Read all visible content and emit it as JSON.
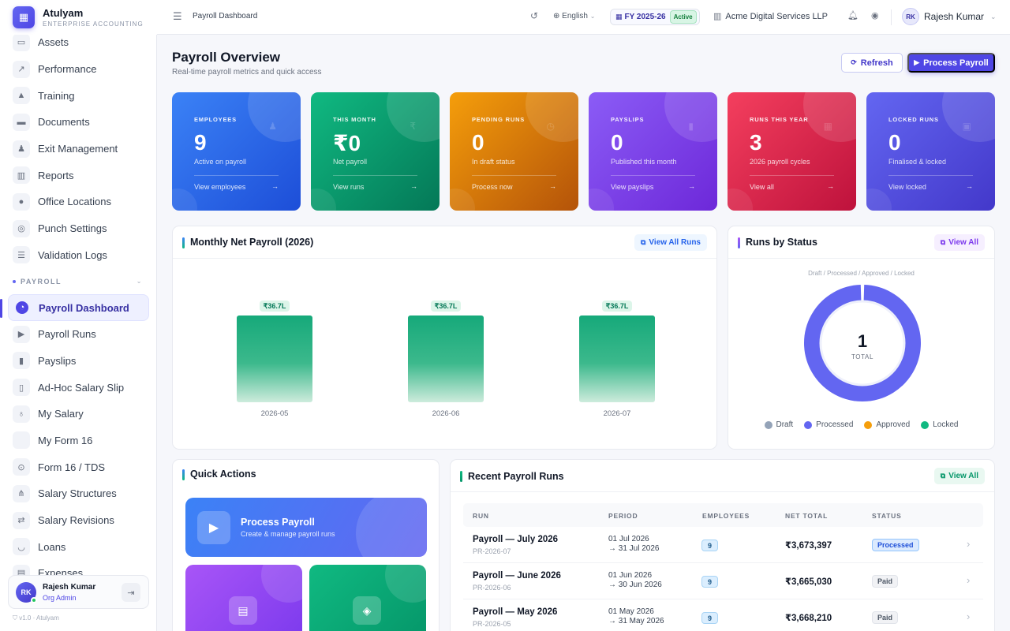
{
  "brand": {
    "name": "Atulyam",
    "subtitle": "ENTERPRISE ACCOUNTING"
  },
  "sidebar": {
    "items_top": [
      {
        "label": "Assets",
        "icon": "laptop-icon"
      },
      {
        "label": "Performance",
        "icon": "chart-line-icon"
      },
      {
        "label": "Training",
        "icon": "graduation-cap-icon"
      },
      {
        "label": "Documents",
        "icon": "folder-icon"
      },
      {
        "label": "Exit Management",
        "icon": "user-exit-icon"
      },
      {
        "label": "Reports",
        "icon": "report-chart-icon"
      },
      {
        "label": "Office Locations",
        "icon": "map-pin-icon"
      },
      {
        "label": "Punch Settings",
        "icon": "fingerprint-icon"
      },
      {
        "label": "Validation Logs",
        "icon": "list-check-icon"
      }
    ],
    "section_label": "PAYROLL",
    "items_payroll": [
      {
        "label": "Payroll Dashboard",
        "icon": "gauge-icon",
        "active": true
      },
      {
        "label": "Payroll Runs",
        "icon": "play-circle-icon"
      },
      {
        "label": "Payslips",
        "icon": "file-icon"
      },
      {
        "label": "Ad-Hoc Salary Slip",
        "icon": "file-plus-icon"
      },
      {
        "label": "My Salary",
        "icon": "money-bag-icon"
      },
      {
        "label": "My Form 16",
        "icon": "blank-icon"
      },
      {
        "label": "Form 16 / TDS",
        "icon": "hand-coin-icon"
      },
      {
        "label": "Salary Structures",
        "icon": "sitemap-icon"
      },
      {
        "label": "Salary Revisions",
        "icon": "exchange-icon"
      },
      {
        "label": "Loans",
        "icon": "hand-holding-icon"
      },
      {
        "label": "Expenses",
        "icon": "receipt-icon"
      }
    ],
    "user": {
      "initials": "RK",
      "name": "Rajesh Kumar",
      "role": "Org Admin"
    },
    "version": "v1.0 · Atulyam"
  },
  "topbar": {
    "breadcrumb": "Payroll Dashboard",
    "language": "English",
    "fy": "FY 2025-26",
    "fy_status": "Active",
    "org": "Acme Digital Services LLP",
    "user_initials": "RK",
    "user_name": "Rajesh Kumar"
  },
  "page": {
    "title": "Payroll Overview",
    "subtitle": "Real-time payroll metrics and quick access",
    "refresh_label": "Refresh",
    "process_label": "Process Payroll"
  },
  "stats": [
    {
      "label": "EMPLOYEES",
      "value": "9",
      "desc": "Active on payroll",
      "link": "View employees",
      "color1": "#3b82f6",
      "color2": "#1d4ed8",
      "icon": "users-icon"
    },
    {
      "label": "THIS MONTH",
      "value": "₹0",
      "desc": "Net payroll",
      "link": "View runs",
      "color1": "#10b981",
      "color2": "#047857",
      "icon": "rupee-icon"
    },
    {
      "label": "PENDING RUNS",
      "value": "0",
      "desc": "In draft status",
      "link": "Process now",
      "color1": "#f59e0b",
      "color2": "#b45309",
      "icon": "clock-icon"
    },
    {
      "label": "PAYSLIPS",
      "value": "0",
      "desc": "Published this month",
      "link": "View payslips",
      "color1": "#8b5cf6",
      "color2": "#6d28d9",
      "icon": "file-icon"
    },
    {
      "label": "RUNS THIS YEAR",
      "value": "3",
      "desc": "2026 payroll cycles",
      "link": "View all",
      "color1": "#f43f5e",
      "color2": "#be123c",
      "icon": "calendar-icon"
    },
    {
      "label": "LOCKED RUNS",
      "value": "0",
      "desc": "Finalised & locked",
      "link": "View locked",
      "color1": "#6366f1",
      "color2": "#4338ca",
      "icon": "lock-icon"
    }
  ],
  "monthly_panel": {
    "title": "Monthly Net Payroll (2026)",
    "button": "View All Runs"
  },
  "status_panel": {
    "title": "Runs by Status",
    "button": "View All",
    "subtitle": "Draft / Processed / Approved / Locked",
    "total": "1",
    "total_label": "TOTAL"
  },
  "chart_data": [
    {
      "type": "bar",
      "title": "Monthly Net Payroll (2026)",
      "categories": [
        "2026-05",
        "2026-06",
        "2026-07"
      ],
      "values": [
        36.7,
        36.7,
        36.7
      ],
      "value_labels": [
        "₹36.7L",
        "₹36.7L",
        "₹36.7L"
      ],
      "unit": "lakh ₹",
      "ylim": [
        0,
        40
      ],
      "bar_color": "#10b981",
      "grid": false
    },
    {
      "type": "pie",
      "title": "Runs by Status",
      "categories": [
        "Draft",
        "Processed",
        "Approved",
        "Locked"
      ],
      "values": [
        0,
        1,
        0,
        0
      ],
      "colors": [
        "#94a3b8",
        "#6366f1",
        "#f59e0b",
        "#10b981"
      ],
      "legend": "bottom"
    }
  ],
  "quick_actions": {
    "title": "Quick Actions",
    "main": {
      "title": "Process Payroll",
      "subtitle": "Create & manage payroll runs"
    },
    "cards": [
      {
        "icon": "document-icon",
        "color1": "#a855f7",
        "color2": "#7c3aed"
      },
      {
        "icon": "layers-icon",
        "color1": "#10b981",
        "color2": "#059669"
      }
    ]
  },
  "recent_runs": {
    "title": "Recent Payroll Runs",
    "button": "View All",
    "columns": [
      "RUN",
      "PERIOD",
      "EMPLOYEES",
      "NET TOTAL",
      "STATUS"
    ],
    "rows": [
      {
        "run": "Payroll — July 2026",
        "code": "PR-2026-07",
        "from": "01 Jul 2026",
        "to": "→ 31 Jul 2026",
        "employees": "9",
        "net": "₹3,673,397",
        "status": "Processed",
        "status_class": "processed"
      },
      {
        "run": "Payroll — June 2026",
        "code": "PR-2026-06",
        "from": "01 Jun 2026",
        "to": "→ 30 Jun 2026",
        "employees": "9",
        "net": "₹3,665,030",
        "status": "Paid",
        "status_class": "paid"
      },
      {
        "run": "Payroll — May 2026",
        "code": "PR-2026-05",
        "from": "01 May 2026",
        "to": "→ 31 May 2026",
        "employees": "9",
        "net": "₹3,668,210",
        "status": "Paid",
        "status_class": "paid"
      }
    ]
  }
}
